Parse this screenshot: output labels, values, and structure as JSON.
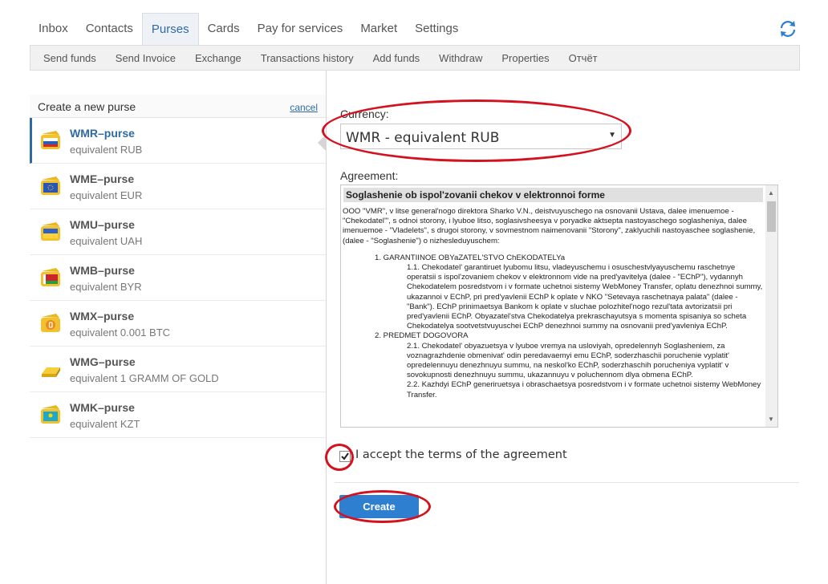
{
  "tabs": [
    {
      "label": "Inbox"
    },
    {
      "label": "Contacts"
    },
    {
      "label": "Purses"
    },
    {
      "label": "Cards"
    },
    {
      "label": "Pay for services"
    },
    {
      "label": "Market"
    },
    {
      "label": "Settings"
    }
  ],
  "subnav": [
    {
      "label": "Send funds"
    },
    {
      "label": "Send Invoice"
    },
    {
      "label": "Exchange"
    },
    {
      "label": "Transactions history"
    },
    {
      "label": "Add funds"
    },
    {
      "label": "Withdraw"
    },
    {
      "label": "Properties"
    },
    {
      "label": "Отчёт"
    }
  ],
  "left": {
    "title": "Create a new purse",
    "cancel": "cancel",
    "purses": [
      {
        "name": "WMR–purse",
        "desc": "equivalent RUB"
      },
      {
        "name": "WME–purse",
        "desc": "equivalent EUR"
      },
      {
        "name": "WMU–purse",
        "desc": "equivalent UAH"
      },
      {
        "name": "WMB–purse",
        "desc": "equivalent BYR"
      },
      {
        "name": "WMX–purse",
        "desc": "equivalent 0.001 BTC"
      },
      {
        "name": "WMG–purse",
        "desc": "equivalent 1 GRAMM OF GOLD"
      },
      {
        "name": "WMK–purse",
        "desc": "equivalent KZT"
      }
    ]
  },
  "form": {
    "currency_label": "Currency:",
    "currency_value": "WMR - equivalent RUB",
    "agreement_label": "Agreement:",
    "agreement_title": "Soglashenie ob ispol'zovanii chekov v elektronnoi forme",
    "agreement_intro": "OOO \"VMR\", v litse general'nogo direktora Sharko V.N., deistvuyuschego na osnovanii Ustava, dalee imenuemoe - \"Chekodatel'\", s odnoi storony, i lyuboe litso, soglasivsheesya v poryadke aktsepta nastoyaschego soglasheniya, dalee imenuemoe - \"Vladelets\", s drugoi storony, v sovmestnom naimenovanii \"Storony\", zaklyuchili nastoyaschee soglashenie, (dalee - \"Soglashenie\") o nizhesleduyuschem:",
    "agreement_s1": "1. GARANTIINOE OBYaZATEL'STVO ChEKODATELYa",
    "agreement_s1_1": "1.1. Chekodatel' garantiruet lyubomu litsu, vladeyuschemu i osuschestvlyayuschemu raschetnye operatsii s ispol'zovaniem chekov v elektronnom vide na pred'yavitelya (dalee - \"EChP\"), vydannyh Chekodatelem posredstvom i v formate uchetnoi sistemy WebMoney Transfer, oplatu denezhnoi summy, ukazannoi v EChP, pri pred'yavlenii EChP k oplate v NKO \"Setevaya raschetnaya palata\" (dalee - \"Bank\"). EChP prinimaetsya Bankom k oplate v sluchae polozhitel'nogo rezul'tata avtorizatsii pri pred'yavlenii EChP. Obyazatel'stva Chekodatelya prekraschayutsya s momenta spisaniya so scheta Chekodatelya sootvetstvuyuschei EChP denezhnoi summy na osnovanii pred'yavleniya EChP.",
    "agreement_s2": "2. PREDMET DOGOVORA",
    "agreement_s2_1": "2.1. Chekodatel' obyazuetsya v lyuboe vremya na usloviyah, opredelennyh Soglasheniem, za voznagrazhdenie obmenivat' odin peredavaemyi emu EChP, soderzhaschii poruchenie vyplatit' opredelennuyu denezhnuyu summu, na neskol'ko EChP, soderzhaschih porucheniya vyplatit' v sovokupnosti denezhnuyu summu, ukazannuyu v poluchennom dlya obmena EChP.",
    "agreement_s2_2": "2.2. Kazhdyi EChP generiruetsya i obraschaetsya posredstvom i v formate uchetnoi sistemy WebMoney Transfer.",
    "accept_label": "I accept the terms of the agreement",
    "create_label": "Create"
  },
  "colors": {
    "accent": "#2e6aa6",
    "button": "#2e7fd0",
    "annotation": "#d4111e"
  },
  "icons": [
    "refresh-icon",
    "wallet-icon",
    "checkbox-check-icon"
  ]
}
